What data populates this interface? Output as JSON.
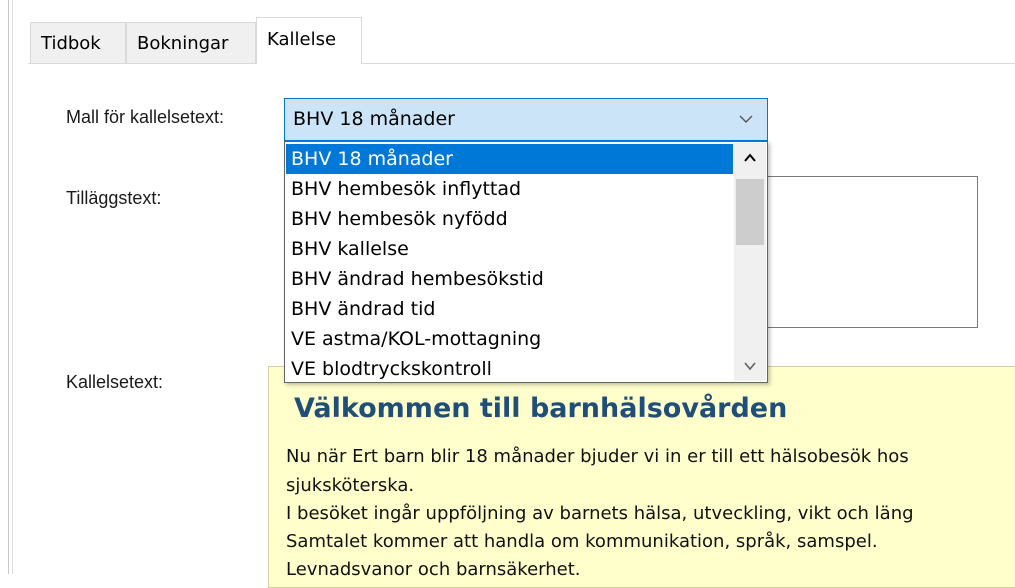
{
  "tabs": [
    {
      "label": "Tidbok"
    },
    {
      "label": "Bokningar"
    },
    {
      "label": "Kallelse",
      "active": true
    }
  ],
  "labels": {
    "mall": "Mall för kallelsetext:",
    "tillagg": "Tilläggstext:",
    "kallelse": "Kallelsetext:"
  },
  "combo": {
    "selected": "BHV 18 månader",
    "arrow_icon": "chevron-down-icon"
  },
  "dropdown": {
    "options": [
      "BHV 18 månader",
      "BHV hembesök inflyttad",
      "BHV hembesök nyfödd",
      "BHV kallelse",
      "BHV ändrad hembesökstid",
      "BHV ändrad tid",
      "VE astma/KOL-mottagning",
      "VE blodtryckskontroll"
    ],
    "selected_index": 0
  },
  "kallelse": {
    "heading": "Välkommen till barnhälsovården",
    "lines": [
      "Nu när Ert barn blir 18 månader bjuder vi in er till ett hälsobesök hos",
      "sjuksköterska.",
      "I besöket ingår uppföljning av barnets hälsa, utveckling, vikt och läng",
      "Samtalet kommer att handla om kommunikation, språk, samspel.",
      "Levnadsvanor och barnsäkerhet."
    ]
  },
  "colors": {
    "selection": "#0078d7",
    "combo_bg": "#cce4f7",
    "heading": "#1f4e79",
    "note_bg": "#ffffcc"
  }
}
